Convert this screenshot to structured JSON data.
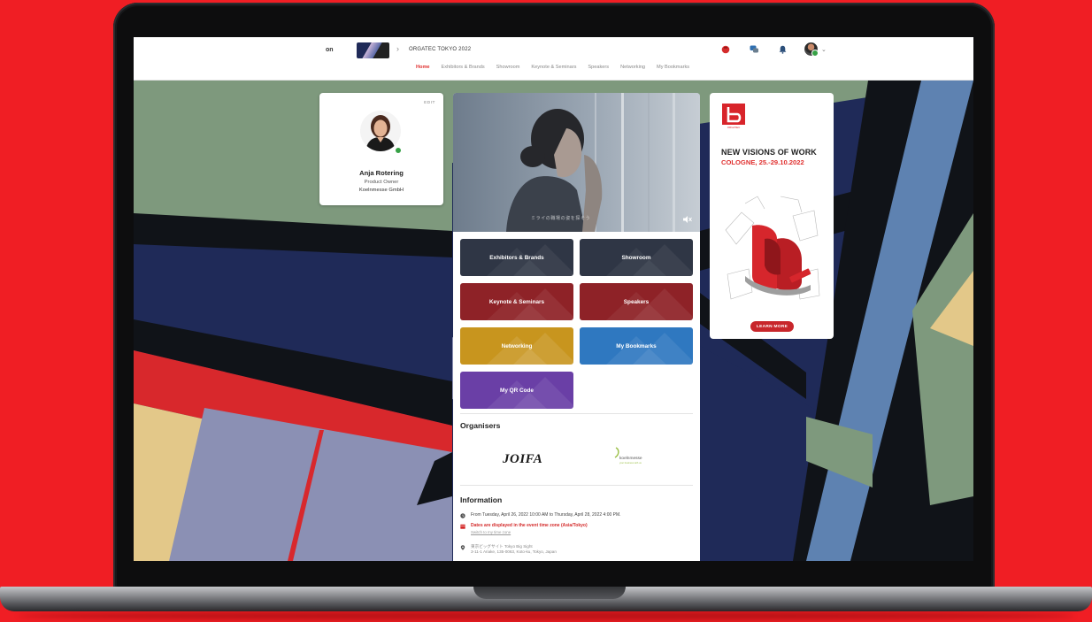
{
  "header": {
    "brand": "on",
    "event_title": "ORGATEC TOKYO 2022",
    "breadcrumb_sep": "›",
    "nav": [
      {
        "label": "Home",
        "active": true
      },
      {
        "label": "Exhibitors & Brands",
        "active": false
      },
      {
        "label": "Showroom",
        "active": false
      },
      {
        "label": "Keynote & Seminars",
        "active": false
      },
      {
        "label": "Speakers",
        "active": false
      },
      {
        "label": "Networking",
        "active": false
      },
      {
        "label": "My Bookmarks",
        "active": false
      }
    ],
    "icons": [
      "red-circle-icon",
      "chat-icon",
      "bell-icon",
      "avatar"
    ]
  },
  "profile": {
    "edit_label": "EDIT",
    "name": "Anja Rotering",
    "role": "Product Owner",
    "company": "Koelnmesse GmbH"
  },
  "video": {
    "caption": "ミライの職場の姿を探そう"
  },
  "tiles": [
    {
      "label": "Exhibitors & Brands",
      "color": "#2f3645"
    },
    {
      "label": "Showroom",
      "color": "#2f3645"
    },
    {
      "label": "Keynote & Seminars",
      "color": "#8e2227"
    },
    {
      "label": "Speakers",
      "color": "#8e2227"
    },
    {
      "label": "Networking",
      "color": "#c8951e"
    },
    {
      "label": "My Bookmarks",
      "color": "#2f78c0"
    },
    {
      "label": "My QR Code",
      "color": "#6a3fa6"
    }
  ],
  "organisers": {
    "title": "Organisers",
    "logos": [
      "JOIFA",
      "koelnmesse"
    ],
    "km_sub": "your business with us"
  },
  "information": {
    "title": "Information",
    "dates": "From Tuesday, April 26, 2022 10:00 AM to Thursday, April 28, 2022 4:00 PM.",
    "timezone_notice": "Dates are displayed in the event time zone (Asia/Tokyo)",
    "switch_link": "Switch to my time zone",
    "venue_name": "東京ビッグサイト Tokyo Big Sight",
    "venue_address": "3-11-1 Ariake, 135-0063, Koto-ku, Tokyo, Japan"
  },
  "ad": {
    "logo_text": "ORGATEC",
    "headline": "NEW VISIONS OF WORK",
    "subline": "COLOGNE, 25.-29.10.2022",
    "cta": "LEARN MORE"
  },
  "colors": {
    "accent": "#e0302f",
    "page_bg": "#f01e24",
    "online": "#37a146"
  }
}
